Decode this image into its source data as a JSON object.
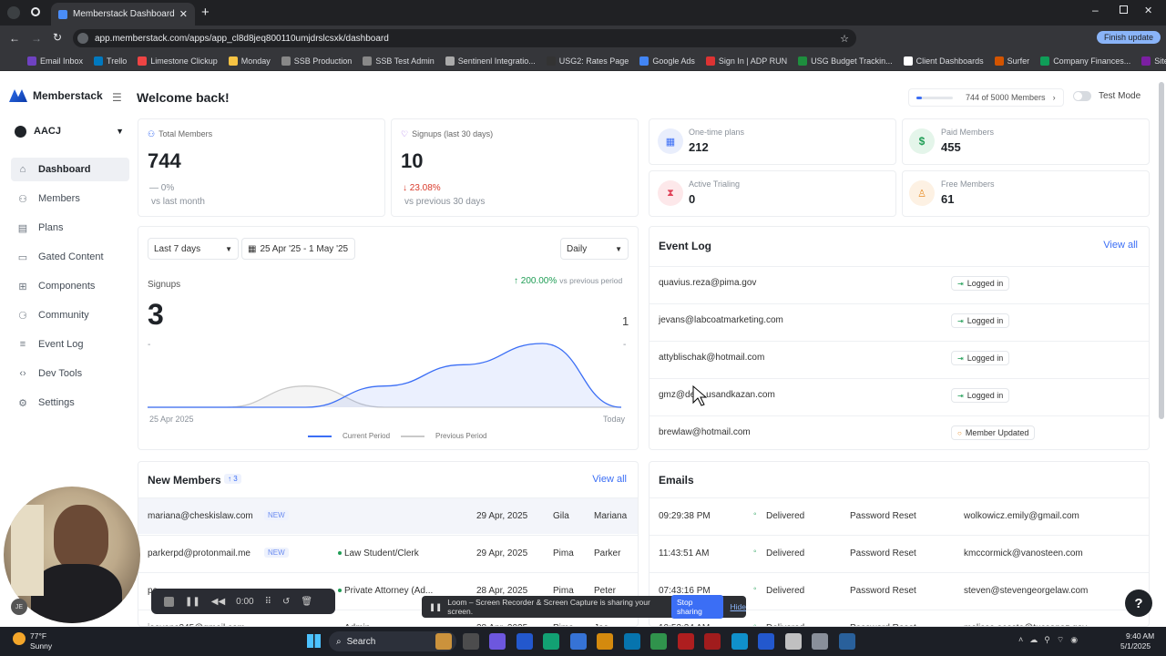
{
  "browser": {
    "tab_title": "Memberstack Dashboard",
    "url": "app.memberstack.com/apps/app_cl8d8jeq800110umjdrslcsxk/dashboard",
    "finish_update": "Finish update",
    "bookmarks": [
      "Email Inbox",
      "Trello",
      "Limestone Clickup",
      "Monday",
      "SSB Production",
      "SSB Test Admin",
      "Sentinenl Integratio...",
      "USG2: Rates Page",
      "Google Ads",
      "Sign In | ADP RUN",
      "USG Budget Trackin...",
      "Client Dashboards",
      "Surfer",
      "Company Finances...",
      "Sitelink Web Edition"
    ]
  },
  "app": {
    "brand": "Memberstack",
    "workspace": "AACJ",
    "nav": [
      "Dashboard",
      "Members",
      "Plans",
      "Gated Content",
      "Components",
      "Community",
      "Event Log",
      "Dev Tools",
      "Settings"
    ],
    "page_title": "Welcome back!",
    "members_quota": "744 of 5000 Members",
    "members_quota_fraction": 0.149,
    "test_mode": "Test Mode"
  },
  "stats": {
    "total_members": {
      "label": "Total Members",
      "value": "744",
      "change": "— 0%",
      "compare": "vs last month"
    },
    "signups": {
      "label": "Signups (last 30 days)",
      "value": "10",
      "change": "↓ 23.08%",
      "compare": "vs previous 30 days"
    },
    "one_time": {
      "label": "One-time plans",
      "value": "212"
    },
    "paid": {
      "label": "Paid Members",
      "value": "455"
    },
    "trialing": {
      "label": "Active Trialing",
      "value": "0"
    },
    "free": {
      "label": "Free Members",
      "value": "61"
    }
  },
  "chart_panel": {
    "range_select": "Last 7 days",
    "date_range": "25 Apr '25 - 1 May '25",
    "interval": "Daily",
    "metric": "Signups",
    "value": "3",
    "change": "↑ 200.00%",
    "change_compare": "vs previous period",
    "prev_value": "1",
    "dash_left": "-",
    "dash_right": "-",
    "x_start": "25 Apr 2025",
    "x_end": "Today",
    "legend_current": "Current Period",
    "legend_previous": "Previous Period"
  },
  "chart_data": {
    "type": "area",
    "x": [
      "25 Apr 2025",
      "",
      "",
      "",
      "",
      "",
      "Today"
    ],
    "series": [
      {
        "name": "Current Period",
        "values": [
          0,
          0,
          0,
          1,
          2,
          3,
          0
        ]
      },
      {
        "name": "Previous Period",
        "values": [
          0,
          0,
          1,
          0,
          0,
          0,
          0
        ]
      }
    ]
  },
  "event_log": {
    "title": "Event Log",
    "view_all": "View all",
    "rows": [
      {
        "email": "quavius.reza@pima.gov",
        "event": "Logged in"
      },
      {
        "email": "jevans@labcoatmarketing.com",
        "event": "Logged in"
      },
      {
        "email": "attyblischak@hotmail.com",
        "event": "Logged in"
      },
      {
        "email": "gmz@de",
        "email_rest": "usandkazan.com",
        "event": "Logged in"
      },
      {
        "email": "brewlaw@hotmail.com",
        "event": "Member Updated"
      }
    ]
  },
  "new_members": {
    "title": "New Members",
    "count": "↑ 3",
    "view_all": "View all",
    "rows": [
      {
        "email": "mariana@cheskislaw.com",
        "badge": "NEW",
        "plan": "",
        "date": "29 Apr, 2025",
        "county": "Gila",
        "name": "Mariana"
      },
      {
        "email": "parkerpd@protonmail.me",
        "badge": "NEW",
        "plan": "Law Student/Clerk",
        "date": "29 Apr, 2025",
        "county": "Pima",
        "name": "Parker"
      },
      {
        "email": "pe",
        "badge": "",
        "plan": "Private Attorney (Ad...",
        "date": "28 Apr, 2025",
        "county": "Pima",
        "name": "Peter"
      },
      {
        "email": "jeevans345@gmail.com",
        "badge": "",
        "plan": "Admin",
        "date": "28 Apr, 2025",
        "county": "Pima",
        "name": "Joe"
      }
    ]
  },
  "emails": {
    "title": "Emails",
    "rows": [
      {
        "time": "09:29:38 PM",
        "status": "Delivered",
        "type": "Password Reset",
        "to": "wolkowicz.emily@gmail.com"
      },
      {
        "time": "11:43:51 AM",
        "status": "Delivered",
        "type": "Password Reset",
        "to": "kmccormick@vanosteen.com"
      },
      {
        "time": "07:43:16 PM",
        "status": "Delivered",
        "type": "Password Reset",
        "to": "steven@stevengeorgelaw.com"
      },
      {
        "time": "10:53:34 AM",
        "status": "Delivered",
        "type": "Password Reset",
        "to": "melissa.acosta@tucsonaz.gov"
      }
    ]
  },
  "overlays": {
    "loom_text": "Loom – Screen Recorder & Screen Capture is sharing your screen.",
    "stop_sharing": "Stop sharing",
    "hide": "Hide",
    "rec_time": "0:00",
    "avatar_initials": "JE"
  },
  "taskbar": {
    "weather_temp": "77°F",
    "weather_desc": "Sunny",
    "search": "Search",
    "time": "9:40 AM",
    "date": "5/1/2025"
  }
}
